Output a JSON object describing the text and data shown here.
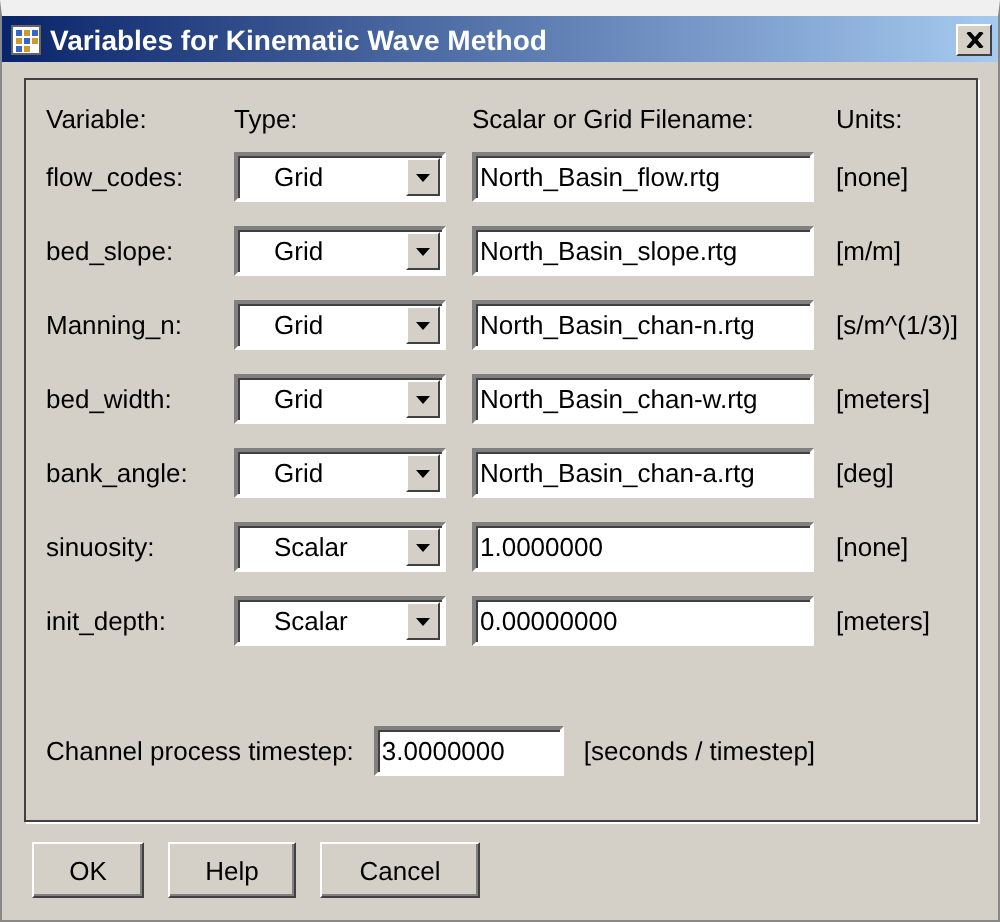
{
  "window": {
    "title": "Variables for Kinematic Wave Method"
  },
  "headers": {
    "variable": "Variable:",
    "type": "Type:",
    "filename": "Scalar or Grid Filename:",
    "units": "Units:"
  },
  "rows": [
    {
      "variable": "flow_codes:",
      "type": "Grid",
      "value": "North_Basin_flow.rtg",
      "units": "[none]"
    },
    {
      "variable": "bed_slope:",
      "type": "Grid",
      "value": "North_Basin_slope.rtg",
      "units": "[m/m]"
    },
    {
      "variable": "Manning_n:",
      "type": "Grid",
      "value": "North_Basin_chan-n.rtg",
      "units": "[s/m^(1/3)]"
    },
    {
      "variable": "bed_width:",
      "type": "Grid",
      "value": "North_Basin_chan-w.rtg",
      "units": "[meters]"
    },
    {
      "variable": "bank_angle:",
      "type": "Grid",
      "value": "North_Basin_chan-a.rtg",
      "units": "[deg]"
    },
    {
      "variable": "sinuosity:",
      "type": "Scalar",
      "value": "1.0000000",
      "units": "[none]"
    },
    {
      "variable": "init_depth:",
      "type": "Scalar",
      "value": "0.00000000",
      "units": "[meters]"
    }
  ],
  "timestep": {
    "label": "Channel process timestep:",
    "value": "3.0000000",
    "units": "[seconds / timestep]"
  },
  "buttons": [
    "OK",
    "Help",
    "Cancel"
  ]
}
